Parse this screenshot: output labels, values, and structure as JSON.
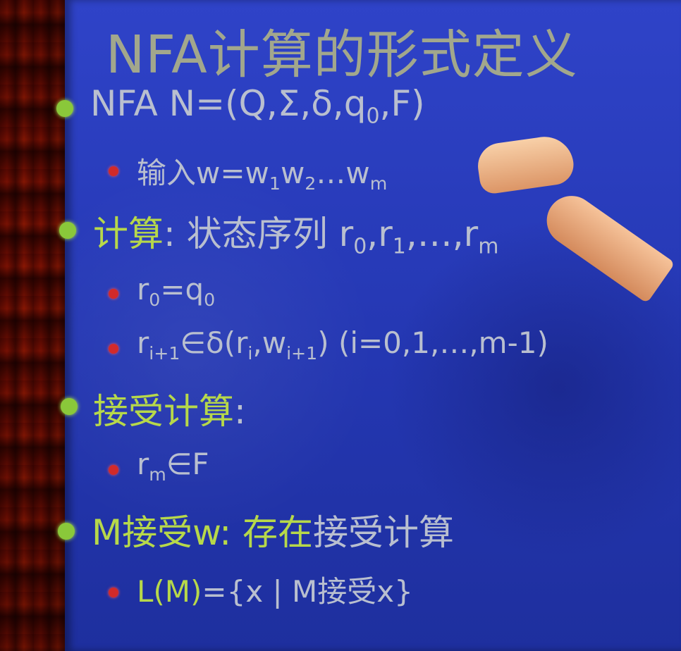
{
  "slide": {
    "title": "NFA计算的形式定义",
    "items": [
      {
        "level": 1,
        "text": "NFA N=(Q,Σ,δ,q",
        "sub": "0",
        "tail": ",F)"
      },
      {
        "level": 2,
        "prefix": "输入w=w",
        "s1": "1",
        "mid": "w",
        "s2": "2",
        "mid2": "…w",
        "s3": "m"
      },
      {
        "level": 1,
        "hl": "计算",
        "text": ": 状态序列 r",
        "s0": "0",
        "mid": ",r",
        "s1": "1",
        "tail": ",…,r",
        "s2": "m"
      },
      {
        "level": 2,
        "text": "r",
        "s0": "0",
        "mid": "=q",
        "s1": "0"
      },
      {
        "level": 2,
        "text": "r",
        "s0": "i+1",
        "mid": "∈δ(r",
        "s1": "i",
        "mid2": ",w",
        "s2": "i+1",
        "tail": ")  (i=0,1,…,m-1)"
      },
      {
        "level": 1,
        "hl": "接受计算",
        "text": ":"
      },
      {
        "level": 2,
        "text": "r",
        "s0": "m",
        "tail": "∈F"
      },
      {
        "level": 1,
        "hl": "M接受w: 存在",
        "text": "接受计算"
      },
      {
        "level": 2,
        "hl": "L(M)",
        "text": "={x | M接受x}"
      }
    ]
  },
  "colors": {
    "board": "#2a3bb8",
    "text": "#b9bfcf",
    "highlight": "#b7d84a",
    "bullet_l1": "#8ac83a",
    "bullet_l2": "#d22a2a"
  }
}
